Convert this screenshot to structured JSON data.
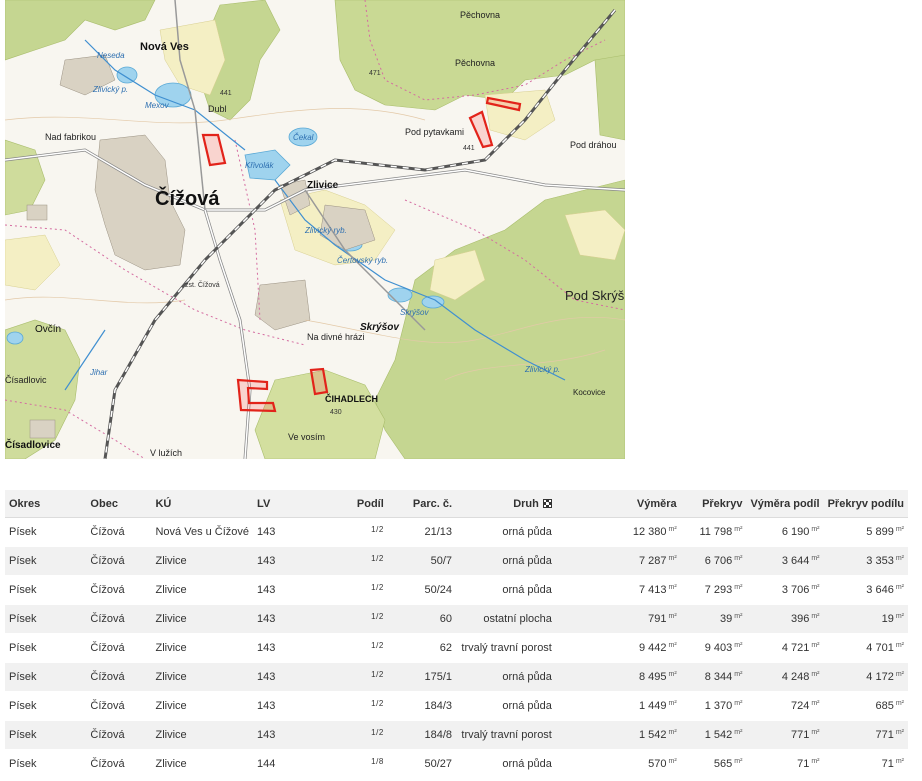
{
  "map": {
    "labels": {
      "nova_ves": "Nová Ves",
      "pechovna_top": "Pěchovna",
      "pechovna": "Pěchovna",
      "neseda": "Neseda",
      "zlivicky_p_1": "Zlivický p.",
      "mexov": "Mexov",
      "elev_441": "441",
      "dubl": "Dubl",
      "elev_471": "471",
      "nad_fabrikou": "Nad fabrikou",
      "cekal": "Čekal",
      "pod_pytavkami": "Pod pytavkami",
      "elev_441b": "441",
      "pod_drahou": "Pod dráhou",
      "krivolak": "Křivolák",
      "zlivice": "Zlivice",
      "cizova": "Čížová",
      "zlivicky_ryb": "Zlivický ryb.",
      "certovsky_ryb": "Čertovský ryb.",
      "pod_skrys": "Pod Skrýš",
      "zst_cizova": "žst. Čížová",
      "skrysov_ryb": "Skrýšov",
      "ovcin": "Ovčín",
      "na_divne_hrazi": "Na divné hrázi",
      "skrysov": "Skrýšov",
      "cisadlovic": "Čísadlovic",
      "jihar": "Jihar",
      "cihadlech": "ČIHADLECH",
      "elev_430": "430",
      "kocovice": "Kocovice",
      "zlivicky_p_2": "Zlivický p.",
      "ve_vosim": "Ve vosím",
      "cisadlovice": "Čísadlovice",
      "v_luzich": "V lužích"
    }
  },
  "table": {
    "headers": {
      "okres": "Okres",
      "obec": "Obec",
      "ku": "KÚ",
      "lv": "LV",
      "podil": "Podíl",
      "parc": "Parc. č.",
      "druh": "Druh",
      "vymera": "Výměra",
      "prekryv": "Překryv",
      "vymera_podil": "Výměra podíl",
      "prekryv_podilu": "Překryv podílu"
    },
    "unit": "m²",
    "rows": [
      {
        "okres": "Písek",
        "obec": "Čížová",
        "ku": "Nová Ves u Čížové",
        "lv": "143",
        "podil": "1/2",
        "parc": "21/13",
        "druh": "orná půda",
        "vymera": "12 380",
        "prekryv": "11 798",
        "vymera_podil": "6 190",
        "prekryv_podilu": "5 899"
      },
      {
        "okres": "Písek",
        "obec": "Čížová",
        "ku": "Zlivice",
        "lv": "143",
        "podil": "1/2",
        "parc": "50/7",
        "druh": "orná půda",
        "vymera": "7 287",
        "prekryv": "6 706",
        "vymera_podil": "3 644",
        "prekryv_podilu": "3 353"
      },
      {
        "okres": "Písek",
        "obec": "Čížová",
        "ku": "Zlivice",
        "lv": "143",
        "podil": "1/2",
        "parc": "50/24",
        "druh": "orná půda",
        "vymera": "7 413",
        "prekryv": "7 293",
        "vymera_podil": "3 706",
        "prekryv_podilu": "3 646"
      },
      {
        "okres": "Písek",
        "obec": "Čížová",
        "ku": "Zlivice",
        "lv": "143",
        "podil": "1/2",
        "parc": "60",
        "druh": "ostatní plocha",
        "vymera": "791",
        "prekryv": "39",
        "vymera_podil": "396",
        "prekryv_podilu": "19"
      },
      {
        "okres": "Písek",
        "obec": "Čížová",
        "ku": "Zlivice",
        "lv": "143",
        "podil": "1/2",
        "parc": "62",
        "druh": "trvalý travní porost",
        "vymera": "9 442",
        "prekryv": "9 403",
        "vymera_podil": "4 721",
        "prekryv_podilu": "4 701"
      },
      {
        "okres": "Písek",
        "obec": "Čížová",
        "ku": "Zlivice",
        "lv": "143",
        "podil": "1/2",
        "parc": "175/1",
        "druh": "orná půda",
        "vymera": "8 495",
        "prekryv": "8 344",
        "vymera_podil": "4 248",
        "prekryv_podilu": "4 172"
      },
      {
        "okres": "Písek",
        "obec": "Čížová",
        "ku": "Zlivice",
        "lv": "143",
        "podil": "1/2",
        "parc": "184/3",
        "druh": "orná půda",
        "vymera": "1 449",
        "prekryv": "1 370",
        "vymera_podil": "724",
        "prekryv_podilu": "685"
      },
      {
        "okres": "Písek",
        "obec": "Čížová",
        "ku": "Zlivice",
        "lv": "143",
        "podil": "1/2",
        "parc": "184/8",
        "druh": "trvalý travní porost",
        "vymera": "1 542",
        "prekryv": "1 542",
        "vymera_podil": "771",
        "prekryv_podilu": "771"
      },
      {
        "okres": "Písek",
        "obec": "Čížová",
        "ku": "Zlivice",
        "lv": "144",
        "podil": "1/8",
        "parc": "50/27",
        "druh": "orná půda",
        "vymera": "570",
        "prekryv": "565",
        "vymera_podil": "71",
        "prekryv_podilu": "71"
      }
    ]
  }
}
